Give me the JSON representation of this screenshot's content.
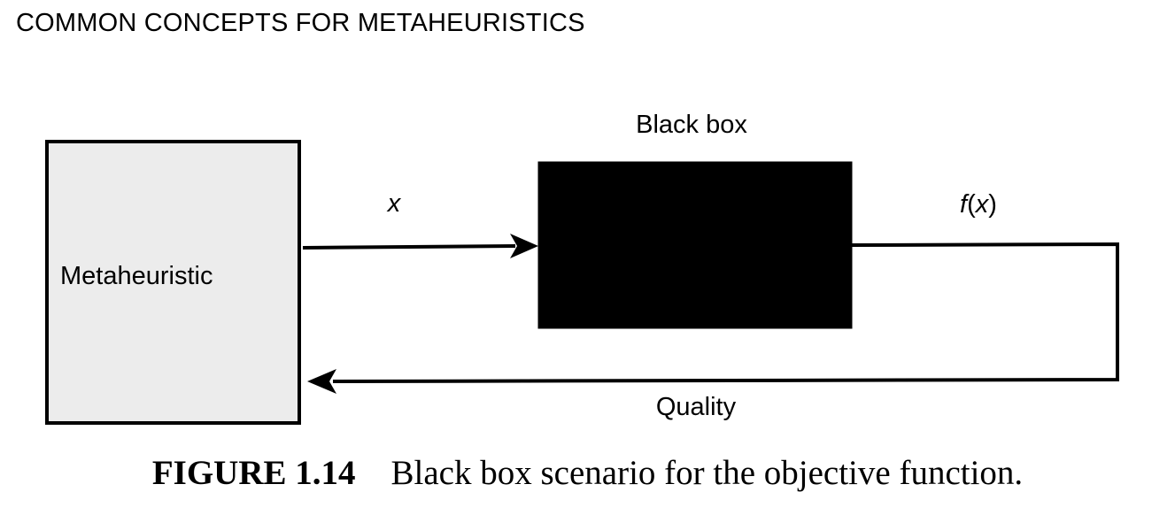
{
  "header": {
    "running_title": "COMMON CONCEPTS FOR METAHEURISTICS"
  },
  "diagram": {
    "metaheuristic_label": "Metaheuristic",
    "black_box_label": "Black box",
    "input_label": "x",
    "output_label_prefix": "f",
    "output_label_open": "(",
    "output_label_var": "x",
    "output_label_close": ")",
    "feedback_label": "Quality",
    "colors": {
      "metaheuristic_fill": "#ececec",
      "black_box_fill": "#000000",
      "stroke": "#000000"
    }
  },
  "caption": {
    "figure_number": "FIGURE 1.14",
    "text": "Black box scenario for the objective function."
  }
}
